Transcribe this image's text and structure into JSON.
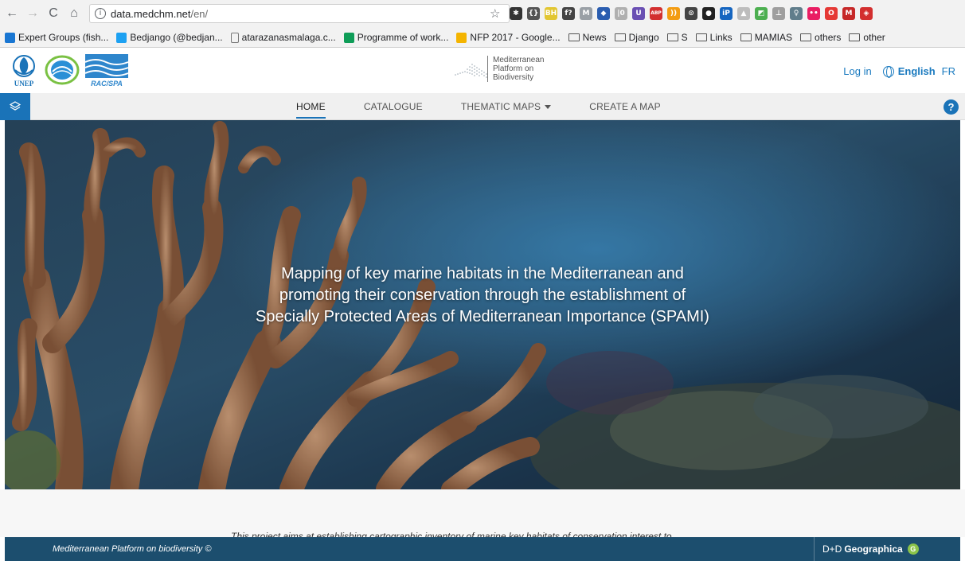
{
  "browser": {
    "url_host": "data.medchm.net",
    "url_path": "/en/",
    "back_icon": "back-arrow",
    "forward_icon": "forward-arrow",
    "reload_icon": "reload",
    "home_icon": "home",
    "info_glyph": "i",
    "bookmark_star_icon": "star",
    "extensions": [
      {
        "name": "extension-icon",
        "color": "#333333",
        "glyph": "✱"
      },
      {
        "name": "extension-icon",
        "color": "#555555",
        "glyph": "{}"
      },
      {
        "name": "extension-icon",
        "color": "#e2c631",
        "glyph": "BH"
      },
      {
        "name": "extension-icon",
        "color": "#444444",
        "glyph": "f?"
      },
      {
        "name": "extension-icon",
        "color": "#9aa0a6",
        "glyph": "M"
      },
      {
        "name": "extension-icon",
        "color": "#2a5db0",
        "glyph": "◆"
      },
      {
        "name": "extension-icon",
        "color": "#b0b0b0",
        "glyph": "|0"
      },
      {
        "name": "extension-icon",
        "color": "#6a4fb3",
        "glyph": "U"
      },
      {
        "name": "extension-icon",
        "color": "#d32f2f",
        "glyph": "ABP"
      },
      {
        "name": "extension-icon",
        "color": "#f39c12",
        "glyph": "))"
      },
      {
        "name": "extension-icon",
        "color": "#444444",
        "glyph": "⊙"
      },
      {
        "name": "extension-icon",
        "color": "#222222",
        "glyph": "●"
      },
      {
        "name": "extension-icon",
        "color": "#1565c0",
        "glyph": "iP"
      },
      {
        "name": "extension-icon",
        "color": "#bdbdbd",
        "glyph": "▲"
      },
      {
        "name": "extension-icon",
        "color": "#4caf50",
        "glyph": "◩"
      },
      {
        "name": "extension-icon",
        "color": "#9e9e9e",
        "glyph": "⊥"
      },
      {
        "name": "extension-icon",
        "color": "#607d8b",
        "glyph": "♀"
      },
      {
        "name": "extension-icon",
        "color": "#e91e63",
        "glyph": "••"
      },
      {
        "name": "extension-icon",
        "color": "#e53935",
        "glyph": "O"
      },
      {
        "name": "extension-icon",
        "color": "#c62828",
        "glyph": "M"
      },
      {
        "name": "extension-icon",
        "color": "#d32f2f",
        "glyph": "◈"
      }
    ],
    "bookmarks": [
      {
        "label": "Expert Groups (fish...",
        "type": "site",
        "color": "#1976d2"
      },
      {
        "label": "Bedjango (@bedjan...",
        "type": "site",
        "color": "#1da1f2"
      },
      {
        "label": "atarazanasmalaga.c...",
        "type": "page",
        "color": "#ffffff"
      },
      {
        "label": "Programme of work...",
        "type": "site",
        "color": "#0f9d58"
      },
      {
        "label": "NFP 2017 - Google...",
        "type": "site",
        "color": "#f4b400"
      },
      {
        "label": "News",
        "type": "folder"
      },
      {
        "label": "Django",
        "type": "folder"
      },
      {
        "label": "S",
        "type": "folder"
      },
      {
        "label": "Links",
        "type": "folder"
      },
      {
        "label": "MAMIAS",
        "type": "folder"
      },
      {
        "label": "others",
        "type": "folder"
      },
      {
        "label": "other",
        "type": "folder"
      }
    ]
  },
  "header": {
    "logo_unep_text": "UNEP",
    "logo_rac_text": "RAC/SPA",
    "platform_line1": "Mediterranean",
    "platform_line2": "Platform on",
    "platform_line3": "Biodiversity",
    "login": "Log in",
    "language": "English",
    "alt_language": "FR"
  },
  "nav": {
    "items": [
      {
        "label": "HOME",
        "active": true
      },
      {
        "label": "CATALOGUE",
        "active": false
      },
      {
        "label": "THEMATIC MAPS",
        "active": false,
        "dropdown": true
      },
      {
        "label": "CREATE A MAP",
        "active": false
      }
    ],
    "help_glyph": "?"
  },
  "hero": {
    "line1": "Mapping of key marine habitats in the Mediterranean and",
    "line2": "promoting their conservation through the establishment of",
    "line3": "Specially Protected Areas of Mediterranean Importance (SPAMI)"
  },
  "content": {
    "intro": "This project aims at establishing cartographic inventory of marine key habitats of conservation interest to"
  },
  "footer": {
    "left": "Mediterranean Platform on biodiversity ©",
    "right_prefix": "D+D",
    "right_brand": "Geographica",
    "right_badge": "G"
  },
  "colors": {
    "brand_blue": "#1a73b8",
    "footer_bg": "#1c4e6e",
    "link_blue": "#1a7abf"
  }
}
